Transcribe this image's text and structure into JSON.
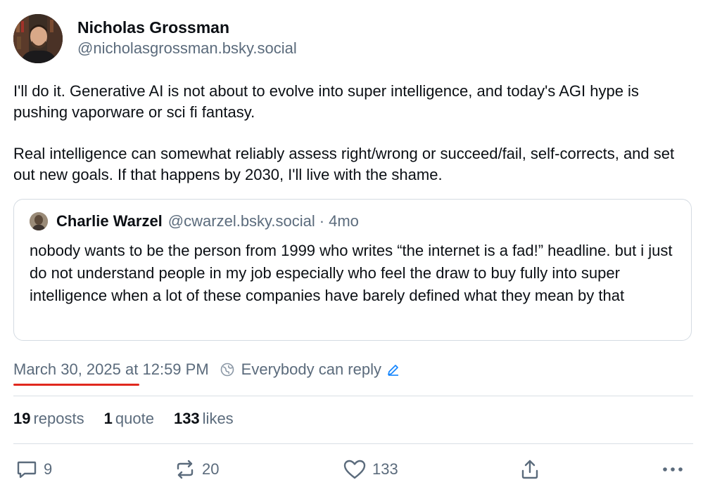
{
  "author": {
    "display_name": "Nicholas Grossman",
    "handle": "@nicholasgrossman.bsky.social"
  },
  "post": {
    "paragraphs": [
      "I'll do it. Generative AI is not about to evolve into super intelligence, and today's AGI hype is pushing vaporware or sci fi fantasy.",
      "Real intelligence can somewhat reliably assess right/wrong or succeed/fail, self-corrects, and set out new goals. If that happens by 2030, I'll live with the shame."
    ]
  },
  "quote": {
    "display_name": "Charlie Warzel",
    "handle": "@cwarzel.bsky.social",
    "separator": "·",
    "time": "4mo",
    "text": "nobody wants to be the person from 1999 who writes “the internet is a fad!” headline. but i just do not understand people in my job especially who feel the draw to buy fully into super intelligence when a lot of these companies have barely defined what they mean by that"
  },
  "meta": {
    "date": "March 30, 2025",
    "at": "at",
    "time": "12:59 PM",
    "reply_setting": "Everybody can reply",
    "underline_color": "#e0281e"
  },
  "stats": {
    "reposts_count": "19",
    "reposts_label": "reposts",
    "quotes_count": "1",
    "quotes_label": "quote",
    "likes_count": "133",
    "likes_label": "likes"
  },
  "actions": {
    "reply_count": "9",
    "repost_count": "20",
    "like_count": "133",
    "icons": [
      "reply-icon",
      "repost-icon",
      "like-icon",
      "share-icon",
      "more-icon"
    ]
  },
  "colors": {
    "text": "#0b0f14",
    "secondary": "#5b6b7c",
    "accent": "#1083fe",
    "border": "#d4dbe2"
  }
}
